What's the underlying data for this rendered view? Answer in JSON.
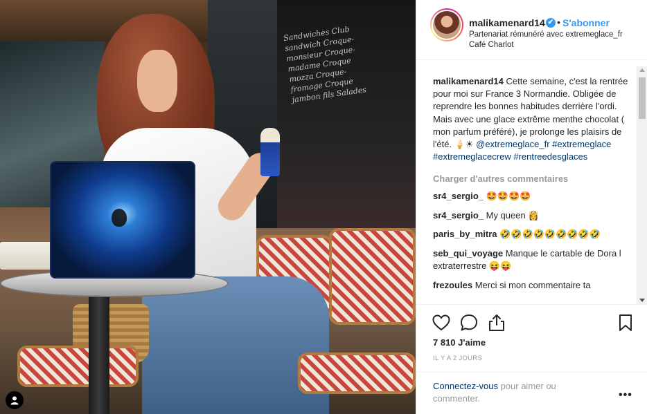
{
  "header": {
    "username": "malikamenard14",
    "verified_mark": "✔",
    "separator": "•",
    "follow_label": "S'abonner",
    "partnership_prefix": "Partenariat rémunéré avec ",
    "partner_name": "extremeglace_fr",
    "location": "Café Charlot"
  },
  "photo": {
    "chalk_text": "Sandwiches Club sandwich Croque-monsieur Croque-madame Croque mozza Croque-fromage Croque jambon fils Salades"
  },
  "caption": {
    "username": "malikamenard14",
    "text": " Cette semaine, c'est la rentrée pour moi sur France 3 Normandie. Obligée de reprendre les bonnes habitudes derrière l'ordi. Mais avec une glace extrême menthe chocolat ( mon parfum préféré), je prolonge les plaisirs de l'été. 🍦☀ ",
    "tags": "@extremeglace_fr #extremeglace #extremeglacecrew #rentreedesglaces"
  },
  "load_more_label": "Charger d'autres commentaires",
  "comments": [
    {
      "username": "sr4_sergio_",
      "text": " 🤩🤩🤩🤩"
    },
    {
      "username": "sr4_sergio_",
      "text": " My queen 👸"
    },
    {
      "username": "paris_by_mitra",
      "text": " 🤣🤣🤣🤣🤣🤣🤣🤣🤣"
    },
    {
      "username": "seb_qui_voyage",
      "text": " Manque le cartable de Dora l extraterrestre 😝😝"
    },
    {
      "username": "frezoules",
      "text": " Merci si mon commentaire ta"
    }
  ],
  "actions": {
    "likes": "7 810 J'aime",
    "time": "IL Y A 2 JOURS",
    "icons": [
      "heart-icon",
      "comment-icon",
      "share-icon",
      "bookmark-icon"
    ]
  },
  "login": {
    "link": "Connectez-vous",
    "rest": " pour aimer ou commenter.",
    "more": "•••"
  },
  "colors": {
    "link_blue": "#3897f0",
    "hashtag_blue": "#003569",
    "muted_gray": "#999999",
    "text": "#262626"
  }
}
